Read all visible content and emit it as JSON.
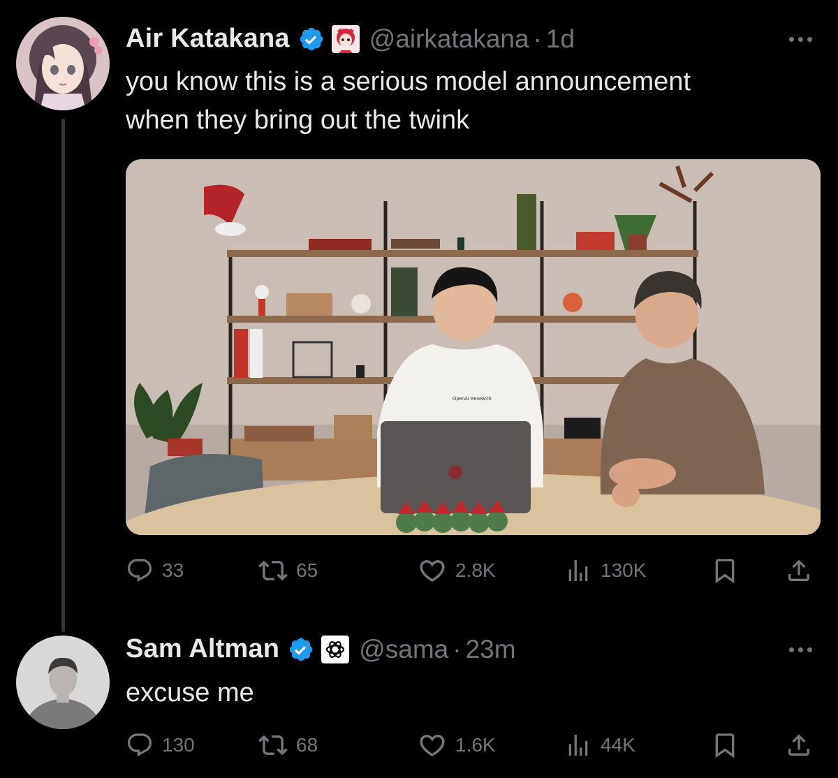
{
  "colors": {
    "background": "#000000",
    "text": "#e7e9ea",
    "muted": "#71767b",
    "verified": "#1d9bf0",
    "thread_line": "#333639"
  },
  "tweets": [
    {
      "author": "Air Katakana",
      "handle": "@airkatakana",
      "separator": "·",
      "time": "1d",
      "verified": true,
      "affiliate_icon": "anime-avatar-icon",
      "text": [
        "you know this is a serious model announcement",
        "when they bring out the twink"
      ],
      "media": {
        "description_icon": "video-thumbnail"
      },
      "stats": {
        "replies": "33",
        "reposts": "65",
        "likes": "2.8K",
        "views": "130K"
      }
    },
    {
      "author": "Sam Altman",
      "handle": "@sama",
      "separator": "·",
      "time": "23m",
      "verified": true,
      "affiliate_icon": "openai-logo-icon",
      "text": [
        "excuse me"
      ],
      "stats": {
        "replies": "130",
        "reposts": "68",
        "likes": "1.6K",
        "views": "44K"
      }
    }
  ],
  "icons": {
    "reply": "reply-icon",
    "repost": "repost-icon",
    "like": "like-icon",
    "views": "views-icon",
    "bookmark": "bookmark-icon",
    "share": "share-icon",
    "more": "more-icon"
  },
  "video_shirt_text": "OpenAI Research"
}
